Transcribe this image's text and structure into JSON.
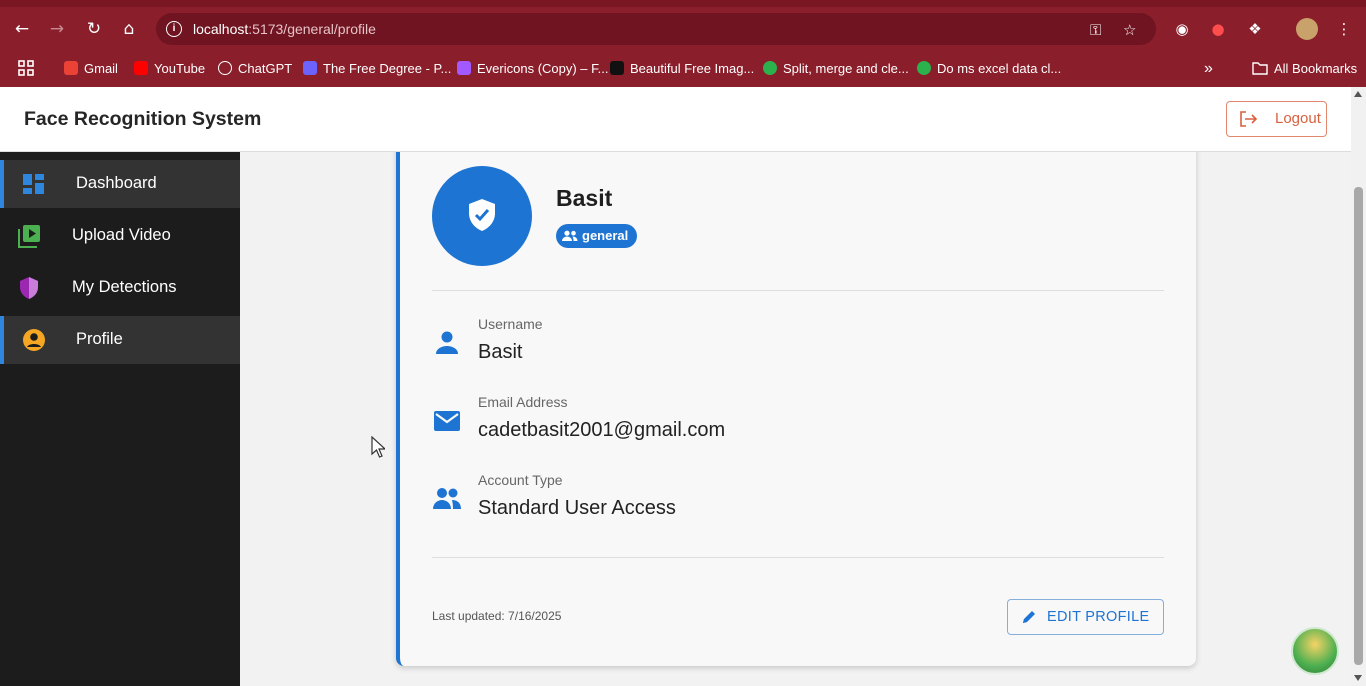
{
  "browser": {
    "url_host": "localhost",
    "url_path": ":5173/general/profile",
    "bookmarks": [
      {
        "label": "Gmail",
        "color": "#ea4335"
      },
      {
        "label": "YouTube",
        "color": "#ff0000"
      },
      {
        "label": "ChatGPT",
        "color": "#ffffff"
      },
      {
        "label": "The Free Degree - P...",
        "color": "#6c63ff"
      },
      {
        "label": "Evericons (Copy) – F...",
        "color": "#a259ff"
      },
      {
        "label": "Beautiful Free Imag...",
        "color": "#111111"
      },
      {
        "label": "Split, merge and cle...",
        "color": "#2bb24c"
      },
      {
        "label": "Do ms excel data cl...",
        "color": "#2bb24c"
      }
    ],
    "more_bookmarks": "»",
    "all_bookmarks": "All Bookmarks"
  },
  "app": {
    "title": "Face Recognition System",
    "logout_label": "Logout"
  },
  "sidebar": {
    "items": [
      {
        "label": "Dashboard",
        "icon": "dashboard-icon",
        "color": "#2e86de"
      },
      {
        "label": "Upload Video",
        "icon": "video-upload-icon",
        "color": "#4caf50"
      },
      {
        "label": "My Detections",
        "icon": "shield-icon",
        "color": "#9c27b0"
      },
      {
        "label": "Profile",
        "icon": "account-circle-icon",
        "color": "#f5a623"
      }
    ],
    "active": [
      "Dashboard",
      "Profile"
    ]
  },
  "profile": {
    "name": "Basit",
    "role": "general",
    "fields": [
      {
        "label": "Username",
        "value": "Basit",
        "icon": "person-icon"
      },
      {
        "label": "Email Address",
        "value": "cadetbasit2001@gmail.com",
        "icon": "mail-icon"
      },
      {
        "label": "Account Type",
        "value": "Standard User Access",
        "icon": "group-icon"
      }
    ],
    "last_updated": "Last updated: 7/16/2025",
    "edit_label": "EDIT PROFILE"
  },
  "colors": {
    "accent": "#1e74d2",
    "chrome": "#8a1e2b",
    "logout": "#d9603e"
  }
}
